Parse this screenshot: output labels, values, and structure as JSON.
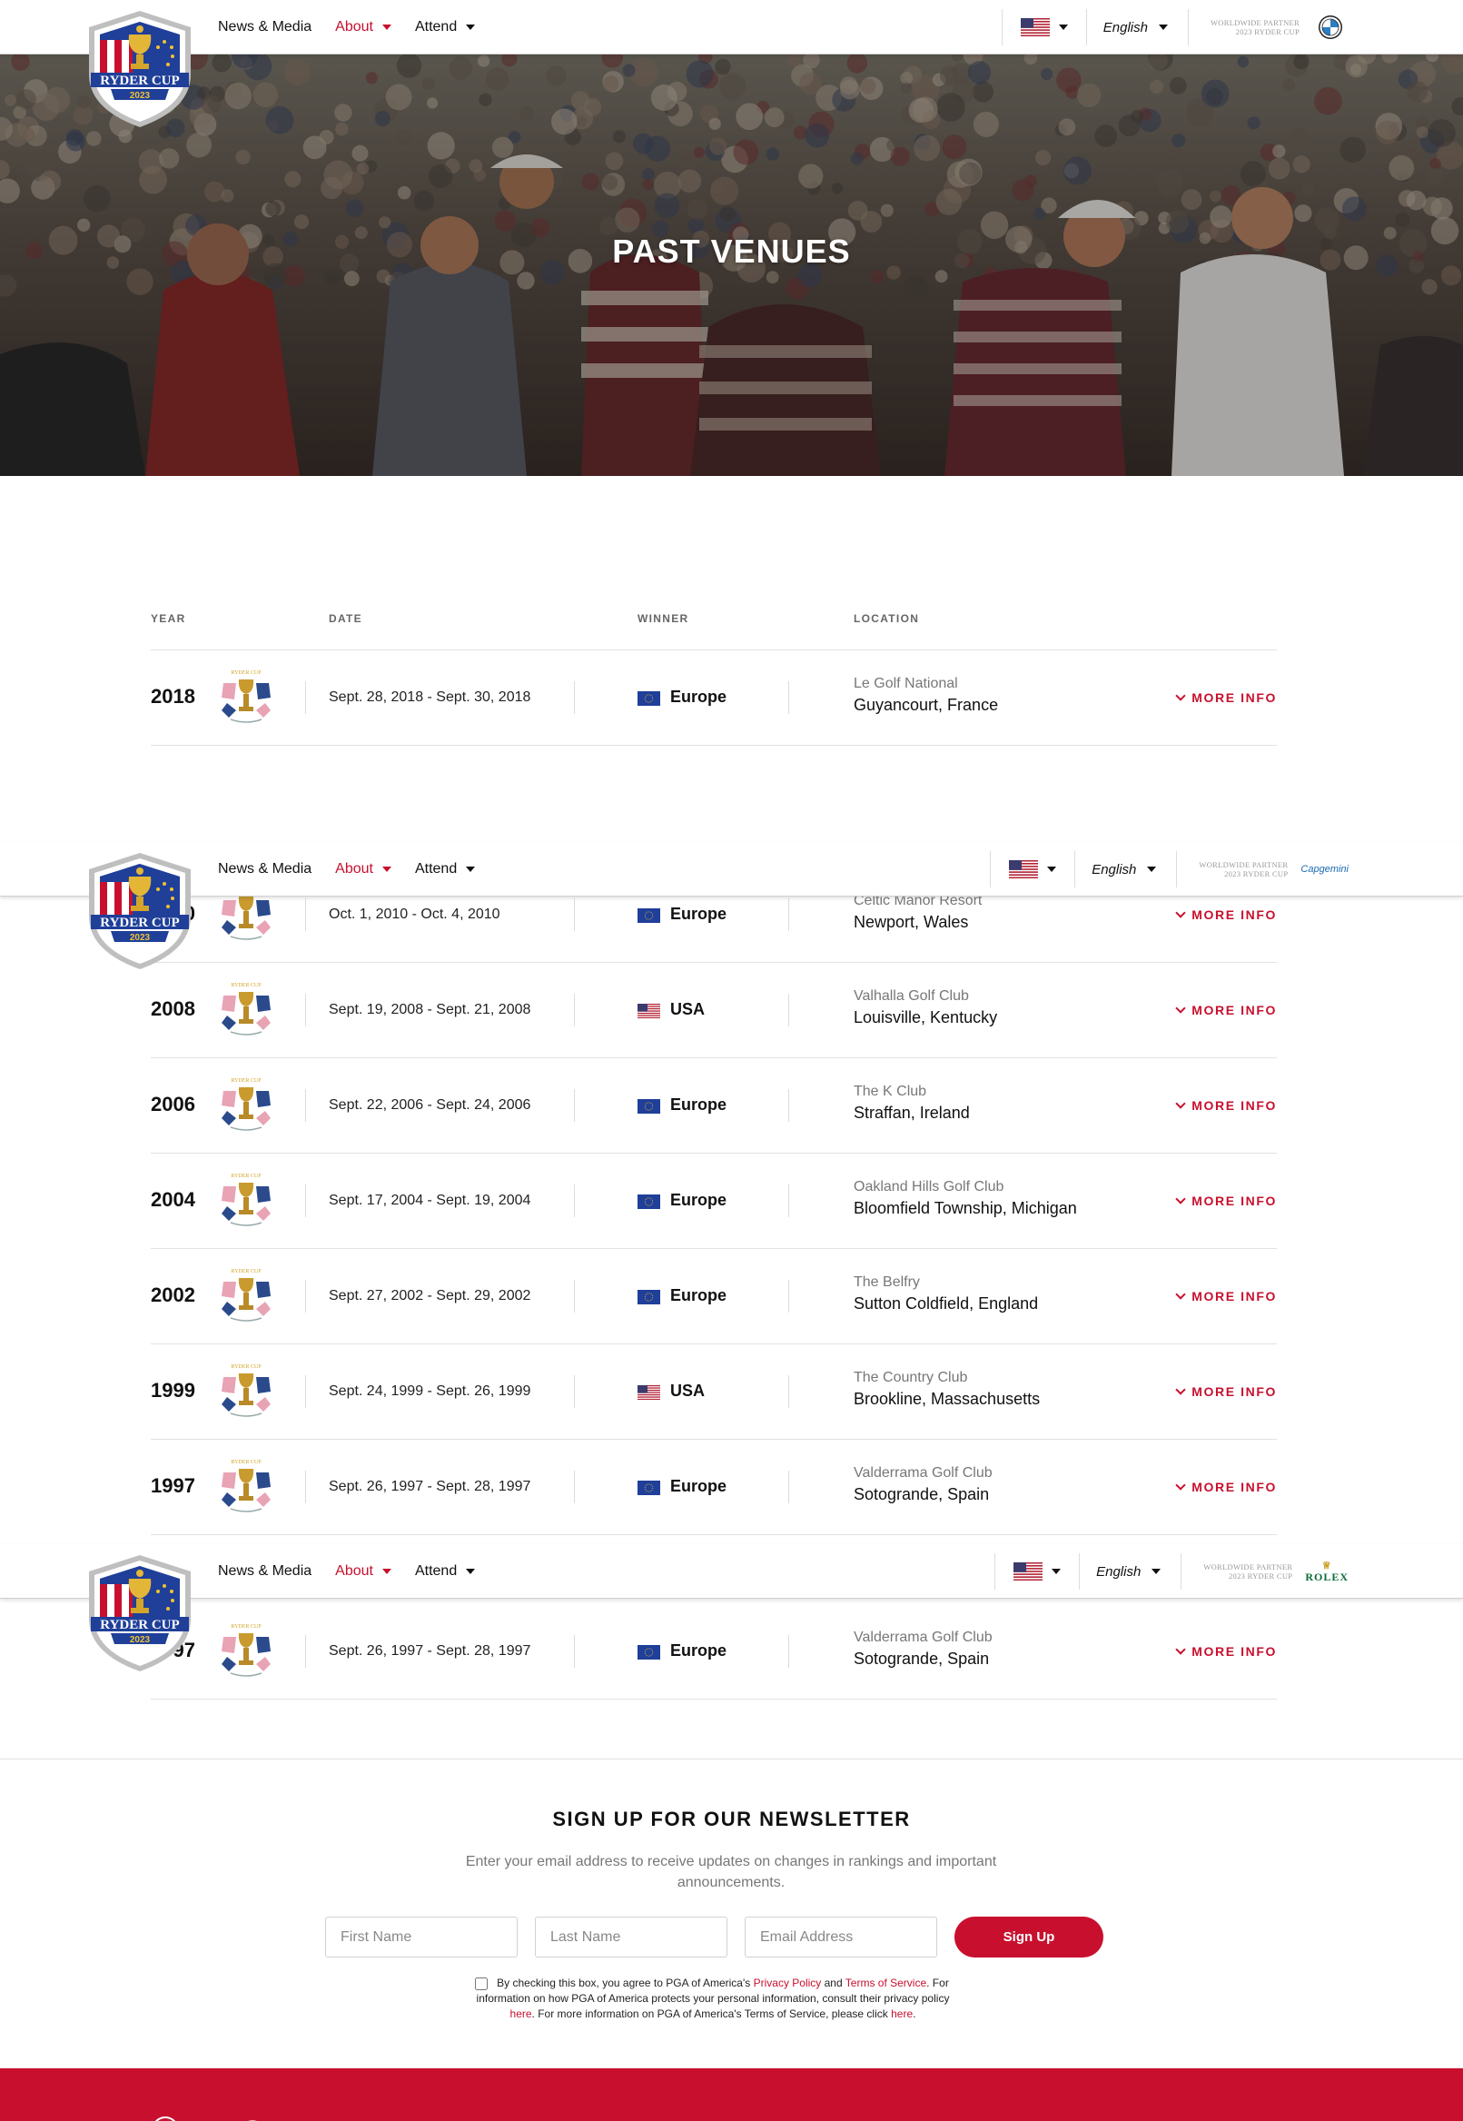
{
  "nav": {
    "items": [
      {
        "label": "News & Media",
        "active": false,
        "dropdown": false
      },
      {
        "label": "About",
        "active": true,
        "dropdown": true
      },
      {
        "label": "Attend",
        "active": false,
        "dropdown": true
      }
    ],
    "language": "English",
    "partner_line1": "Worldwide Partner",
    "partner_line2": "2023 Ryder Cup",
    "sponsors": [
      "BMW",
      "Capgemini",
      "ROLEX"
    ],
    "logo": {
      "top": "RYDER CUP",
      "year": "2023"
    }
  },
  "hero": {
    "title": "PAST VENUES"
  },
  "table": {
    "headers": {
      "year": "YEAR",
      "date": "DATE",
      "winner": "WINNER",
      "location": "LOCATION"
    },
    "more_label": "MORE INFO",
    "rows": [
      {
        "year": "2018",
        "date": "Sept. 28, 2018 - Sept. 30, 2018",
        "winner": "Europe",
        "club": "Le Golf National",
        "city": "Guyancourt, France"
      },
      {
        "year": "2010",
        "date": "Oct. 1, 2010 - Oct. 4, 2010",
        "winner": "Europe",
        "club": "Celtic Manor Resort",
        "city": "Newport, Wales"
      },
      {
        "year": "2008",
        "date": "Sept. 19, 2008 - Sept. 21, 2008",
        "winner": "USA",
        "club": "Valhalla Golf Club",
        "city": "Louisville, Kentucky"
      },
      {
        "year": "2006",
        "date": "Sept. 22, 2006 - Sept. 24, 2006",
        "winner": "Europe",
        "club": "The K Club",
        "city": "Straffan, Ireland"
      },
      {
        "year": "2004",
        "date": "Sept. 17, 2004 - Sept. 19, 2004",
        "winner": "Europe",
        "club": "Oakland Hills Golf Club",
        "city": "Bloomfield Township, Michigan"
      },
      {
        "year": "2002",
        "date": "Sept. 27, 2002 - Sept. 29, 2002",
        "winner": "Europe",
        "club": "The Belfry",
        "city": "Sutton Coldfield, England"
      },
      {
        "year": "1999",
        "date": "Sept. 24, 1999 - Sept. 26, 1999",
        "winner": "USA",
        "club": "The Country Club",
        "city": "Brookline, Massachusetts"
      },
      {
        "year": "1997",
        "date": "Sept. 26, 1997 - Sept. 28, 1997",
        "winner": "Europe",
        "club": "Valderrama Golf Club",
        "city": "Sotogrande, Spain"
      },
      {
        "year": "1997",
        "date": "Sept. 26, 1997 - Sept. 28, 1997",
        "winner": "Europe",
        "club": "Valderrama Golf Club",
        "city": "Sotogrande, Spain"
      }
    ]
  },
  "newsletter": {
    "title": "SIGN UP FOR OUR NEWSLETTER",
    "description": "Enter your email address to receive updates on changes in rankings and important announcements.",
    "first_name_placeholder": "First Name",
    "last_name_placeholder": "Last Name",
    "email_placeholder": "Email Address",
    "button": "Sign Up",
    "legal_pre": "By checking this box, you agree to PGA of America's ",
    "privacy_link": "Privacy Policy",
    "legal_and": " and ",
    "terms_link": "Terms of Service",
    "legal_mid": ". For information on how PGA of America protects your personal information, consult their privacy policy ",
    "here_link1": "here",
    "legal_mid2": ". For more information on PGA of America's Terms of Service, please click ",
    "here_link2": "here",
    "legal_end": "."
  },
  "colors": {
    "accent": "#c8102e",
    "europe_flag": "#1f3f99",
    "text": "#111111"
  }
}
